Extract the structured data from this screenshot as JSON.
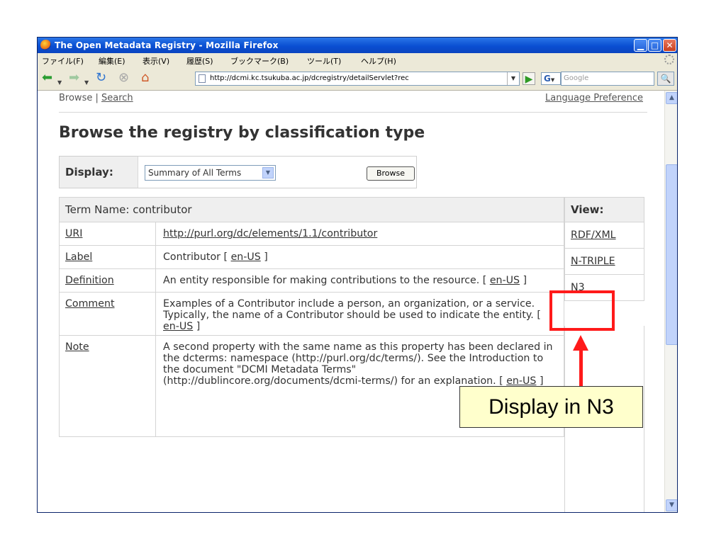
{
  "window": {
    "title": "The Open Metadata Registry - Mozilla Firefox",
    "controls": {
      "minimize": "▁",
      "maximize": "□",
      "close": "✕"
    }
  },
  "menubar": {
    "items": [
      "ファイル(F)",
      "編集(E)",
      "表示(V)",
      "履歴(S)",
      "ブックマーク(B)",
      "ツール(T)",
      "ヘルプ(H)"
    ]
  },
  "navbar": {
    "back_icon": "back-arrow-icon",
    "forward_icon": "forward-arrow-icon",
    "url": "http://dcmi.kc.tsukuba.ac.jp/dcregistry/detailServlet?rec",
    "search_engine_icon": "G",
    "search_placeholder": "Google"
  },
  "page": {
    "topnav": {
      "browse": "Browse",
      "separator": " | ",
      "search": "Search"
    },
    "language_preference": "Language Preference",
    "heading": "Browse the registry by classification type",
    "display": {
      "label": "Display:",
      "selected": "Summary of All Terms",
      "button": "Browse"
    },
    "term_table": {
      "header": "Term Name: contributor",
      "rows": [
        {
          "key": "URI",
          "value": "http://purl.org/dc/elements/1.1/contributor",
          "lang": ""
        },
        {
          "key": "Label",
          "value": "Contributor [ ",
          "lang": "en-US",
          "suffix": " ]"
        },
        {
          "key": "Definition",
          "value": "An entity responsible for making contributions to the resource. [ ",
          "lang": "en-US",
          "suffix": " ]"
        },
        {
          "key": "Comment",
          "value": "Examples of a Contributor include a person, an organization, or a service. Typically, the name of a Contributor should be used to indicate the entity. [ ",
          "lang": "en-US",
          "suffix": " ]"
        },
        {
          "key": "Note",
          "value": "A second property with the same name as this property has been declared in the dcterms: namespace (http://purl.org/dc/terms/). See the Introduction to the document \"DCMI Metadata Terms\" (http://dublincore.org/documents/dcmi-terms/) for an explanation. [ ",
          "lang": "en-US",
          "suffix": " ]"
        }
      ]
    },
    "view_table": {
      "header": "View:",
      "links": [
        "RDF/XML",
        "N-TRIPLE",
        "N3"
      ]
    }
  },
  "annotation": {
    "callout": "Display in N3",
    "highlight_color": "#ff1a1a",
    "callout_bg": "#ffffcc"
  },
  "colors": {
    "titlebar": "#0a4fd2",
    "chrome": "#ece9d8",
    "text": "#333333"
  }
}
